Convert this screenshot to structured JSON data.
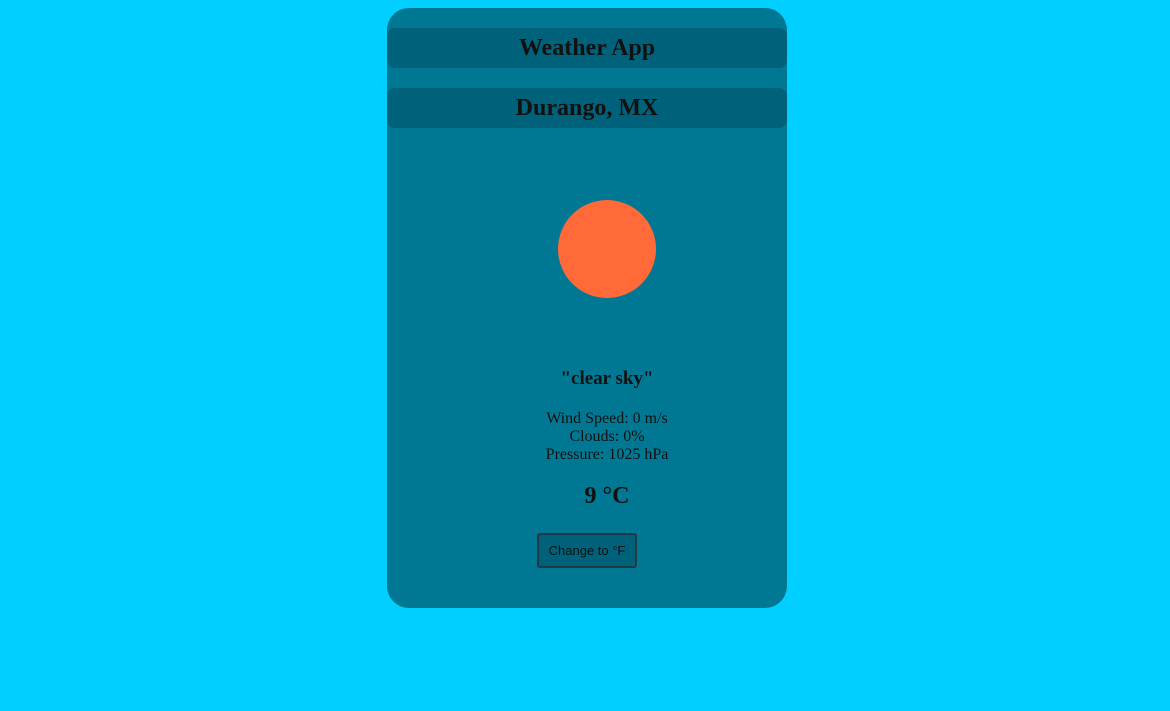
{
  "app": {
    "title": "Weather App"
  },
  "location": {
    "city": "Durango, MX"
  },
  "weather": {
    "icon": "sun-icon",
    "icon_color": "#ff6a38",
    "description": "\"clear sky\"",
    "wind": "Wind Speed: 0 m/s",
    "clouds": "Clouds: 0%",
    "pressure": "Pressure: 1025 hPa",
    "temperature": "9 °C"
  },
  "controls": {
    "unit_toggle_label": "Change to °F"
  },
  "colors": {
    "page_background": "#00cfff",
    "card_background": "#007893",
    "header_bar": "#00627a"
  }
}
